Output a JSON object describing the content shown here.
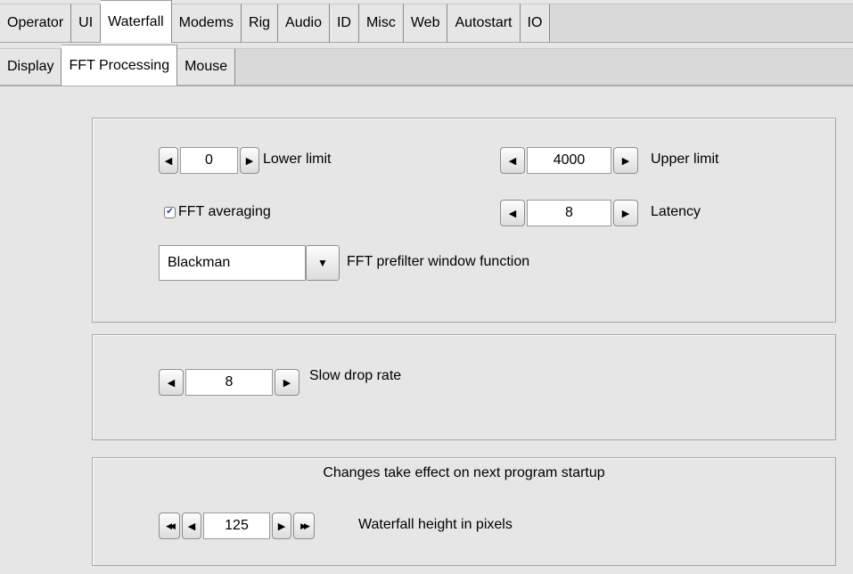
{
  "tabs_primary": [
    {
      "label": "Operator"
    },
    {
      "label": "UI"
    },
    {
      "label": "Waterfall",
      "active": true
    },
    {
      "label": "Modems"
    },
    {
      "label": "Rig"
    },
    {
      "label": "Audio"
    },
    {
      "label": "ID"
    },
    {
      "label": "Misc"
    },
    {
      "label": "Web"
    },
    {
      "label": "Autostart"
    },
    {
      "label": "IO"
    }
  ],
  "tabs_secondary": [
    {
      "label": "Display"
    },
    {
      "label": "FFT Processing",
      "active": true
    },
    {
      "label": "Mouse"
    }
  ],
  "fft_group": {
    "lower_limit": {
      "value": "0",
      "label": "Lower limit"
    },
    "upper_limit": {
      "value": "4000",
      "label": "Upper limit"
    },
    "fft_averaging": {
      "checked": true,
      "label": "FFT averaging"
    },
    "latency": {
      "value": "8",
      "label": "Latency"
    },
    "window_function": {
      "selected": "Blackman",
      "label": "FFT prefilter window function"
    }
  },
  "drop_group": {
    "slow_drop_rate": {
      "value": "8",
      "label": "Slow drop rate"
    }
  },
  "startup_group": {
    "notice": "Changes take effect on next program startup",
    "waterfall_height": {
      "value": "125",
      "label": "Waterfall height in pixels"
    }
  },
  "icons": {
    "left": "◀",
    "right": "▶",
    "fast_left": "◀◀",
    "fast_right": "▶▶",
    "dropdown": "▼",
    "check": "✔"
  }
}
